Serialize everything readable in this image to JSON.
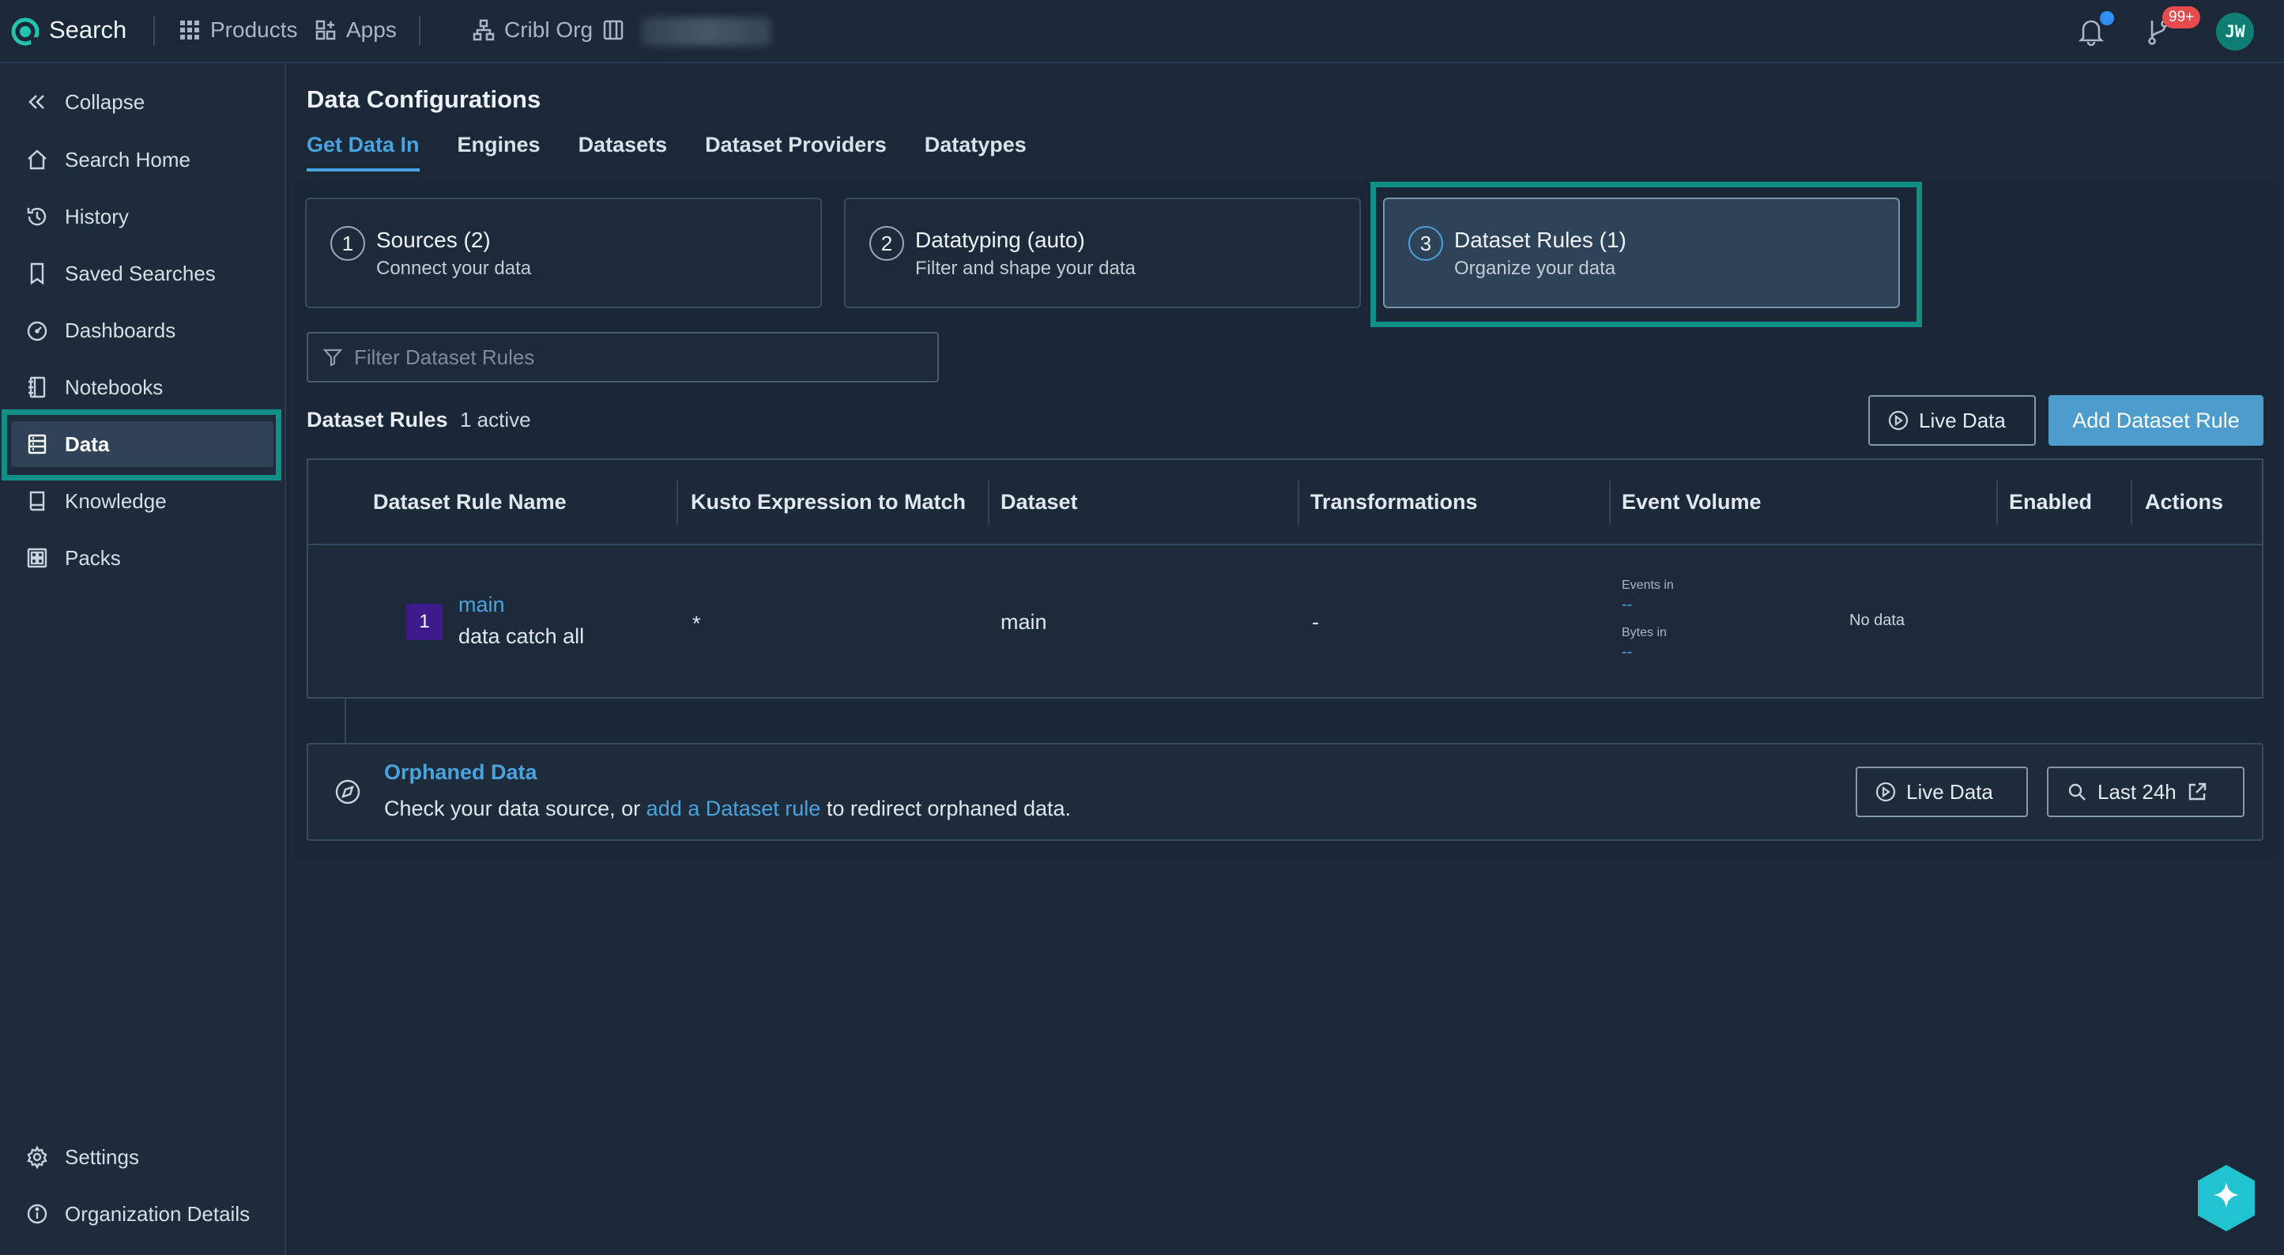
{
  "topbar": {
    "app_title": "Search",
    "products_label": "Products",
    "apps_label": "Apps",
    "org_label": "Cribl Org",
    "notification_badge": "99+",
    "avatar_initials": "JW",
    "accent_color": "#0f8f86"
  },
  "sidebar": {
    "collapse": "Collapse",
    "items": [
      {
        "label": "Search Home",
        "icon": "home-icon"
      },
      {
        "label": "History",
        "icon": "history-icon"
      },
      {
        "label": "Saved Searches",
        "icon": "bookmark-icon"
      },
      {
        "label": "Dashboards",
        "icon": "dashboard-icon"
      },
      {
        "label": "Notebooks",
        "icon": "notebook-icon"
      },
      {
        "label": "Data",
        "icon": "data-icon",
        "active": true
      },
      {
        "label": "Knowledge",
        "icon": "knowledge-icon"
      },
      {
        "label": "Packs",
        "icon": "packs-icon"
      }
    ],
    "settings": "Settings",
    "org_details": "Organization Details"
  },
  "main": {
    "title": "Data Configurations",
    "tabs": [
      {
        "label": "Get Data In",
        "active": true
      },
      {
        "label": "Engines"
      },
      {
        "label": "Datasets"
      },
      {
        "label": "Dataset Providers"
      },
      {
        "label": "Datatypes"
      }
    ],
    "steps": [
      {
        "num": "1",
        "title": "Sources (2)",
        "subtitle": "Connect your data"
      },
      {
        "num": "2",
        "title": "Datatyping (auto)",
        "subtitle": "Filter and shape your data"
      },
      {
        "num": "3",
        "title": "Dataset Rules (1)",
        "subtitle": "Organize your data",
        "active": true
      }
    ],
    "filter_placeholder": "Filter Dataset Rules",
    "rules_heading": "Dataset Rules",
    "rules_count": "1 active",
    "live_data_button": "Live Data",
    "add_rule_button": "Add Dataset Rule",
    "table": {
      "columns": [
        "Dataset Rule Name",
        "Kusto Expression to Match",
        "Dataset",
        "Transformations",
        "Event Volume",
        "Enabled",
        "Actions"
      ],
      "rows": [
        {
          "num": "1",
          "name": "main",
          "description": "data catch all",
          "expression": "*",
          "dataset": "main",
          "transformations": "-",
          "events_in_label": "Events in",
          "events_in_value": "--",
          "bytes_in_label": "Bytes in",
          "bytes_in_value": "--",
          "volume_status": "No data"
        }
      ]
    },
    "orphaned": {
      "title": "Orphaned Data",
      "text_before": "Check your data source, or ",
      "link_text": "add a Dataset rule",
      "text_after": " to redirect orphaned data.",
      "live_data_button": "Live Data",
      "last_button": "Last 24h"
    }
  }
}
